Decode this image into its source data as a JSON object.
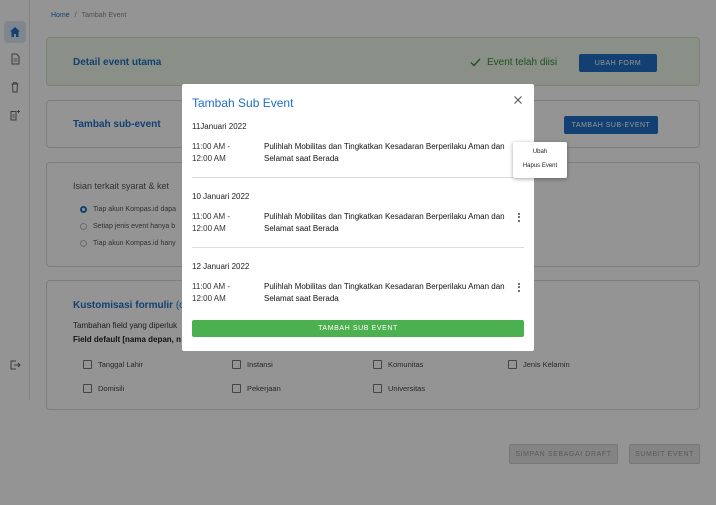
{
  "breadcrumb": {
    "home": "Home",
    "separator": "/",
    "current": "Tambah Event"
  },
  "sidebar": {
    "icons": [
      "home-icon",
      "document-icon",
      "trash-icon",
      "add-document-icon",
      "logout-icon"
    ]
  },
  "sections": {
    "main_detail": {
      "title": "Detail event utama",
      "status": "Event telah diisi",
      "button": "UBAH FORM"
    },
    "sub_event": {
      "title": "Tambah sub-event",
      "button": "TAMBAH SUB-EVENT"
    },
    "terms": {
      "title": "Isian terkait syarat & ket",
      "options": [
        "Tiap akun Kompas.id dapa",
        "Setiap jenis event hanya b",
        "Tiap akun Kompas.id hany"
      ]
    },
    "custom_form": {
      "title": "Kustomisasi formulir",
      "title_suffix": "(op",
      "note": "Tambahan field yang diperluk",
      "default_fields": "Field default [nama depan, n",
      "fields": [
        "Tanggal Lahir",
        "Instansi",
        "Komunitas",
        "Jenis Kelamin",
        "Domisili",
        "Pekerjaan",
        "Universitas"
      ]
    }
  },
  "footer": {
    "draft_button": "SIMPAN SEBAGAI DRAFT",
    "submit_button": "SUMBIT EVENT"
  },
  "modal": {
    "title": "Tambah Sub Event",
    "groups": [
      {
        "date": "11Januari 2022",
        "time_start": "11:00 AM -",
        "time_end": "12:00 AM",
        "title": "Pulihlah Mobilitas dan Tingkatkan Kesadaran Berperilaku Aman dan Selamat saat Berada"
      },
      {
        "date": "10 Januari 2022",
        "time_start": "11:00 AM -",
        "time_end": "12:00 AM",
        "title": "Pulihlah Mobilitas dan Tingkatkan Kesadaran Berperilaku Aman dan Selamat saat Berada"
      },
      {
        "date": "12 Januari 2022",
        "time_start": "11:00 AM -",
        "time_end": "12:00 AM",
        "title": "Pulihlah Mobilitas dan Tingkatkan Kesadaran Berperilaku Aman dan Selamat saat Berada"
      }
    ],
    "add_button": "TAMBAH SUB EVENT"
  },
  "popup_menu": {
    "items": [
      "Ubah",
      "Hapus Event"
    ]
  },
  "colors": {
    "primary": "#1f6fc5",
    "success": "#4caf50",
    "success_text": "#2f8f35",
    "overlay": "rgba(0,0,0,0.42)"
  }
}
